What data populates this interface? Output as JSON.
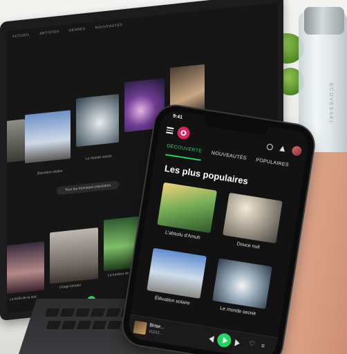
{
  "laptop": {
    "nav": [
      "ACCUEIL",
      "ARTISTES",
      "GENRES",
      "NOUVEAUTÉS"
    ],
    "caption_center": "Élévation solaire",
    "caption_right": "Le monde secret",
    "button_label": "Tous les morceaux populaires",
    "caption_row2_left": "La forêt de la nuit",
    "caption_row2_mid": "Orage lointain",
    "caption_row2_right": "La lumière de la forêt"
  },
  "phone": {
    "time": "9:41",
    "tabs": [
      "DÉCOUVERTE",
      "NOUVEAUTÉS",
      "POPULAIRES"
    ],
    "section_title": "Les plus populaires",
    "cards": [
      {
        "title": "L'absolu d'Amuh"
      },
      {
        "title": "Douce nuit"
      },
      {
        "title": "Élévation solaire"
      },
      {
        "title": "Le monde secret"
      }
    ],
    "now_playing": {
      "title": "Brise...",
      "subtitle": "VIZIO..."
    }
  },
  "bottle_text": "ECOVESSEL"
}
